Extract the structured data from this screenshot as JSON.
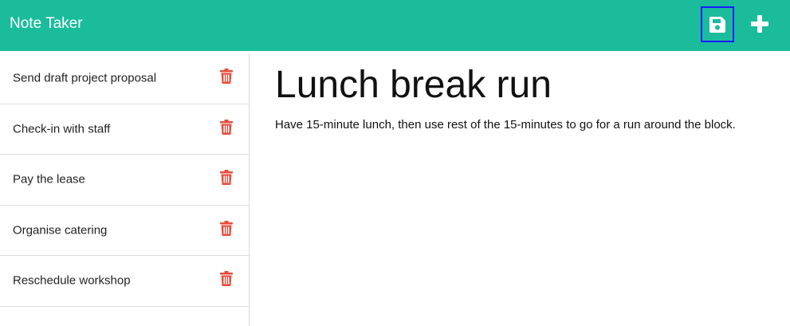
{
  "app": {
    "title": "Note Taker"
  },
  "toolbar": {
    "save_icon": "save-icon",
    "new_icon": "plus-icon"
  },
  "notes": [
    {
      "title": "Send draft project proposal"
    },
    {
      "title": "Check-in with staff"
    },
    {
      "title": "Pay the lease"
    },
    {
      "title": "Organise catering"
    },
    {
      "title": "Reschedule workshop"
    }
  ],
  "editor": {
    "title": "Lunch break run",
    "text": "Have 15-minute lunch, then use rest of the 15-minutes to go for a run around the block."
  },
  "colors": {
    "accent": "#1abc9c",
    "trash": "#e74c3c",
    "focus": "#1a1aff"
  }
}
